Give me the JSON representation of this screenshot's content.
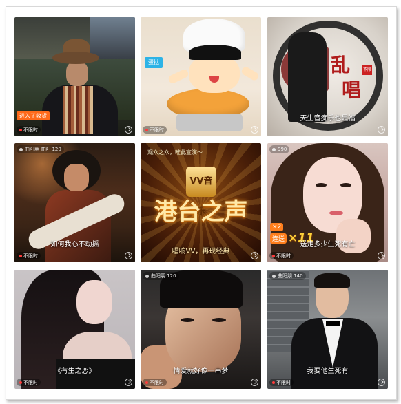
{
  "tiles": [
    {
      "id": 1,
      "top_left": "",
      "caption": "",
      "badge": "进入了收货",
      "status": "不限时"
    },
    {
      "id": 2,
      "top_left": "",
      "caption": "",
      "sticker": "蛋挞",
      "status": "不限时"
    },
    {
      "id": 3,
      "top_left": "",
      "caption": "天生音痴乐也是福",
      "art_chars": [
        "乱",
        "唱"
      ],
      "seal": "不限",
      "status": ""
    },
    {
      "id": 4,
      "top_left": "曲阳朋 曲阳 120",
      "caption": "如何我心不动摇",
      "status": "不限时"
    },
    {
      "id": 5,
      "top_left": "观众之众，唯此宣演～",
      "logo": "VV音乐",
      "title": "港台之声",
      "caption": "唱响VV，再现经典",
      "status": ""
    },
    {
      "id": 6,
      "top_left": "990",
      "caption": "送走多少生死有亡",
      "gift_prefix": "×2",
      "gift_label": "连送",
      "gift_count": "×11",
      "status": "不限时"
    },
    {
      "id": 7,
      "top_left": "",
      "caption": "《有生之恋》",
      "status": "不限时"
    },
    {
      "id": 8,
      "top_left": "曲阳朋 120",
      "caption": "情爱就好像一串梦",
      "status": "不限时"
    },
    {
      "id": 9,
      "top_left": "曲阳朋 140",
      "caption": "我要他生死有",
      "status": "不限时"
    }
  ],
  "icons": {
    "corner": "rotate-icon"
  },
  "colors": {
    "live_dot": "#ff3b3b",
    "badge": "#ff6a1a",
    "title_glow": "#ff9b1a"
  }
}
